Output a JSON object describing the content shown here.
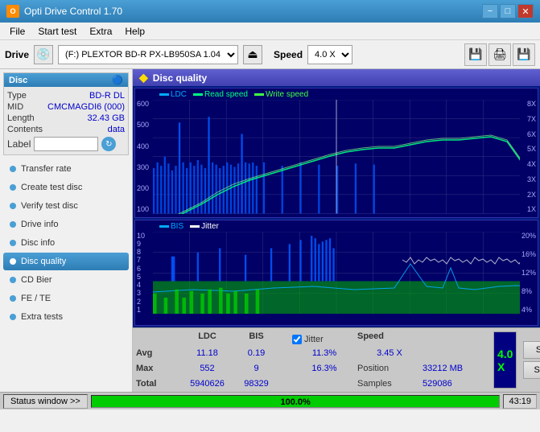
{
  "titlebar": {
    "title": "Opti Drive Control 1.70",
    "minimize": "−",
    "maximize": "□",
    "close": "✕"
  },
  "menubar": {
    "items": [
      "File",
      "Start test",
      "Extra",
      "Help"
    ]
  },
  "drivebar": {
    "drive_label": "Drive",
    "drive_value": "(F:)  PLEXTOR BD-R  PX-LB950SA 1.04",
    "speed_label": "Speed",
    "speed_value": "4.0 X"
  },
  "disc": {
    "title": "Disc",
    "type_label": "Type",
    "type_value": "BD-R DL",
    "mid_label": "MID",
    "mid_value": "CMCMAGDI6 (000)",
    "length_label": "Length",
    "length_value": "32.43 GB",
    "contents_label": "Contents",
    "contents_value": "data",
    "label_label": "Label"
  },
  "sidebar_items": [
    {
      "id": "transfer-rate",
      "label": "Transfer rate",
      "active": false
    },
    {
      "id": "create-test-disc",
      "label": "Create test disc",
      "active": false
    },
    {
      "id": "verify-test-disc",
      "label": "Verify test disc",
      "active": false
    },
    {
      "id": "drive-info",
      "label": "Drive info",
      "active": false
    },
    {
      "id": "disc-info",
      "label": "Disc info",
      "active": false
    },
    {
      "id": "disc-quality",
      "label": "Disc quality",
      "active": true
    },
    {
      "id": "cd-bier",
      "label": "CD Bier",
      "active": false
    },
    {
      "id": "fe-te",
      "label": "FE / TE",
      "active": false
    },
    {
      "id": "extra-tests",
      "label": "Extra tests",
      "active": false
    }
  ],
  "content": {
    "header": "Disc quality"
  },
  "chart_top": {
    "legend": [
      {
        "label": "LDC",
        "color": "#00aaff"
      },
      {
        "label": "Read speed",
        "color": "#00ff00"
      },
      {
        "label": "Write speed",
        "color": "#44ff44"
      }
    ],
    "y_right": [
      "8X",
      "7X",
      "6X",
      "5X",
      "4X",
      "3X",
      "2X",
      "1X"
    ],
    "y_left": [
      "600",
      "500",
      "400",
      "300",
      "200",
      "100"
    ]
  },
  "chart_bottom": {
    "legend": [
      {
        "label": "BIS",
        "color": "#00aaff"
      },
      {
        "label": "Jitter",
        "color": "#ffffff"
      }
    ],
    "y_right": [
      "20%",
      "16%",
      "12%",
      "8%",
      "4%"
    ],
    "y_left": [
      "10",
      "9",
      "8",
      "7",
      "6",
      "5",
      "4",
      "3",
      "2",
      "1"
    ]
  },
  "stats": {
    "columns": [
      "",
      "LDC",
      "BIS",
      "",
      "Jitter",
      "Speed",
      ""
    ],
    "avg_label": "Avg",
    "avg_ldc": "11.18",
    "avg_bis": "0.19",
    "avg_jitter": "11.3%",
    "speed_label": "Speed",
    "speed_value": "3.45 X",
    "max_label": "Max",
    "max_ldc": "552",
    "max_bis": "9",
    "max_jitter": "16.3%",
    "position_label": "Position",
    "position_value": "33212 MB",
    "total_label": "Total",
    "total_ldc": "5940626",
    "total_bis": "98329",
    "samples_label": "Samples",
    "samples_value": "529086",
    "jitter_checked": true,
    "jitter_label": "Jitter",
    "start_full": "Start full",
    "start_part": "Start part"
  },
  "statusbar": {
    "status_window": "Status window >>",
    "progress": "100.0%",
    "time": "43:19"
  }
}
